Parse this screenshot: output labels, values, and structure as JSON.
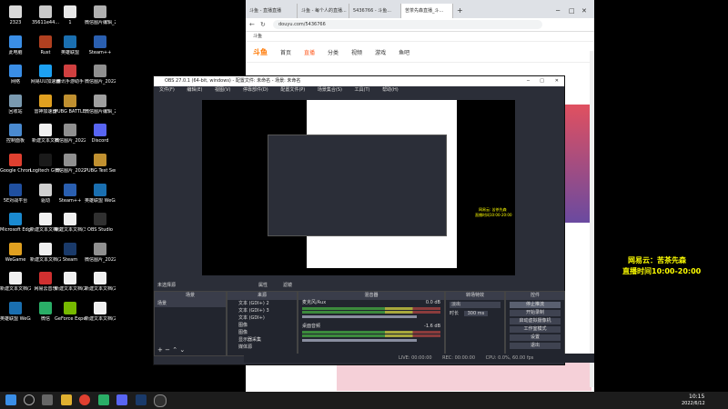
{
  "desktop": {
    "icons": [
      {
        "label": "2323",
        "color": "#d9d9d9"
      },
      {
        "label": "35611e44...",
        "color": "#c9c9c9"
      },
      {
        "label": "1",
        "color": "#e8e8e8"
      },
      {
        "label": "微信图片编辑_20220602...",
        "color": "#b0b0b0"
      },
      {
        "label": "此电脑",
        "color": "#3a8ee6"
      },
      {
        "label": "Rust",
        "color": "#b04020"
      },
      {
        "label": "英雄联盟",
        "color": "#1a6fb0"
      },
      {
        "label": "Steam++",
        "color": "#2a5fb0"
      },
      {
        "label": "网络",
        "color": "#3a8ee6"
      },
      {
        "label": "网易UU加速器",
        "color": "#1da1f2"
      },
      {
        "label": "腾讯手游助手",
        "color": "#d04040"
      },
      {
        "label": "微信图片_2022...",
        "color": "#909090"
      },
      {
        "label": "回收站",
        "color": "#7a9ab0"
      },
      {
        "label": "雷神加速器",
        "color": "#e0a020"
      },
      {
        "label": "PUBG BATTLEGR...",
        "color": "#c09030"
      },
      {
        "label": "微信图片编辑_20220602...",
        "color": "#a0a0a0"
      },
      {
        "label": "控制面板",
        "color": "#4a8ad0"
      },
      {
        "label": "新建文本文档",
        "color": "#f0f0f0"
      },
      {
        "label": "微信图片_2022060...",
        "color": "#909090"
      },
      {
        "label": "Discord",
        "color": "#5865f2"
      },
      {
        "label": "Google Chrome",
        "color": "#e04030"
      },
      {
        "label": "Logitech G HUB",
        "color": "#1a1a1a"
      },
      {
        "label": "微信图片_2022012...",
        "color": "#909090"
      },
      {
        "label": "PUBG Test Server",
        "color": "#c09030"
      },
      {
        "label": "5E对战平台",
        "color": "#2050a0"
      },
      {
        "label": "驱动",
        "color": "#d0d0d0"
      },
      {
        "label": "Steam++",
        "color": "#2a5fb0"
      },
      {
        "label": "英雄联盟 WeGame版",
        "color": "#1a6fb0"
      },
      {
        "label": "Microsoft Edge",
        "color": "#1a8ad0"
      },
      {
        "label": "新建文本文档(2)",
        "color": "#f0f0f0"
      },
      {
        "label": "新建文本文档(3)",
        "color": "#f0f0f0"
      },
      {
        "label": "OBS Studio",
        "color": "#303030"
      },
      {
        "label": "WeGame",
        "color": "#e0a020"
      },
      {
        "label": "新建文本文档(2)(2)",
        "color": "#f0f0f0"
      },
      {
        "label": "Steam",
        "color": "#1a3a6a"
      },
      {
        "label": "微信图片_2022060...",
        "color": "#909090"
      },
      {
        "label": "新建文本文档(2)(2)(1)",
        "color": "#f0f0f0"
      },
      {
        "label": "网易云音乐",
        "color": "#d03030"
      },
      {
        "label": "新建文本文档(2)(2)(4)",
        "color": "#f0f0f0"
      },
      {
        "label": "新建文本文档(2)(2)(3)",
        "color": "#f0f0f0"
      },
      {
        "label": "英雄联盟 WeGame版",
        "color": "#1a6fb0"
      },
      {
        "label": "微信",
        "color": "#2aae67"
      },
      {
        "label": "GeForce Experience",
        "color": "#76b900"
      },
      {
        "label": "新建文本文档(2)(2)(2)",
        "color": "#f0f0f0"
      }
    ]
  },
  "browser": {
    "tabs": [
      "斗鱼 - 直播直播",
      "斗鱼 - 每个人的直播...",
      "5436766 - 斗鱼...",
      "苦茶先森直播_斗..."
    ],
    "url": "douyu.com/5436766",
    "bookmark": "斗鱼",
    "site_nav": [
      "首页",
      "直播",
      "分类",
      "视频",
      "游戏",
      "鱼吧"
    ],
    "site_logo": "斗鱼"
  },
  "obs": {
    "title": "OBS 27.0.1 (64-bit, windows) - 配置文件: 未命名 - 场景: 未命名",
    "menu": [
      "文件(F)",
      "编辑(E)",
      "视图(V)",
      "停靠部件(D)",
      "配置文件(P)",
      "场景集合(S)",
      "工具(T)",
      "帮助(H)"
    ],
    "no_source_label": "未选择源",
    "properties_label": "属性",
    "filters_label": "滤镜",
    "docks": {
      "scenes": {
        "title": "场景",
        "items": [
          "场景"
        ]
      },
      "sources": {
        "title": "来源",
        "items": [
          "文本 (GDI+) 2",
          "文本 (GDI+) 3",
          "文本 (GDI+)",
          "图像",
          "图像",
          "显示器采集",
          "媒体源"
        ]
      },
      "mixer": {
        "title": "混音器",
        "channels": [
          {
            "name": "麦克风/Aux",
            "db": "0.0 dB"
          },
          {
            "name": "桌面音频",
            "db": "-1.6 dB"
          }
        ]
      },
      "transitions": {
        "title": "转场特效",
        "type": "淡出",
        "duration_label": "时长",
        "duration": "300 ms"
      },
      "controls": {
        "title": "控件",
        "buttons": [
          "停止推流",
          "开始录制",
          "启动虚拟摄像机",
          "工作室模式",
          "设置",
          "退出"
        ]
      }
    },
    "status": {
      "live": "LIVE: 00:00:00",
      "rec": "REC: 00:00:00",
      "cpu": "CPU: 0.0%, 60.00 fps"
    },
    "overlay_text": "网易云: 苦茶先森",
    "overlay_time": "直播时间10:00-20:00"
  },
  "stream_overlay": {
    "line1": "网易云：苦茶先森",
    "line2": "直播时间10:00-20:00",
    "color": "#ffff00"
  },
  "taskbar": {
    "time": "10:15",
    "date": "2022/6/12",
    "search_placeholder": "搜索"
  }
}
